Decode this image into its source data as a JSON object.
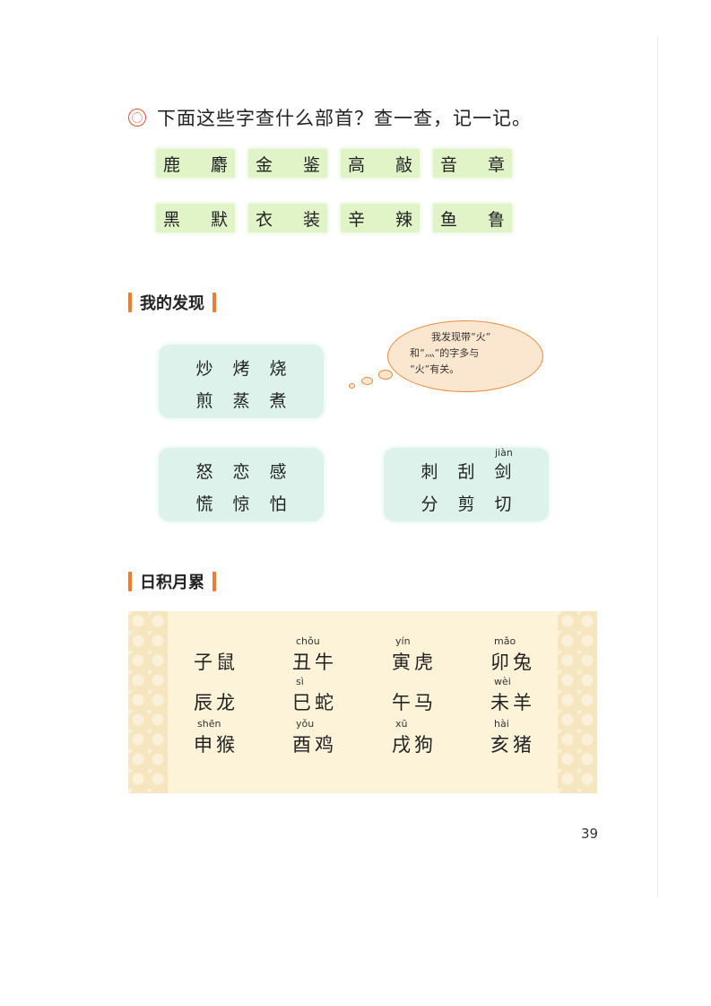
{
  "exercise": {
    "title": "下面这些字查什么部首？查一查，记一记。",
    "row1": [
      "鹿 麝",
      "金 鉴",
      "高 敲",
      "音 章"
    ],
    "row2": [
      "黑 默",
      "衣 装",
      "辛 辣",
      "鱼 鲁"
    ]
  },
  "section1": {
    "title": "我的发现",
    "box1": {
      "line1": [
        "炒",
        "烤",
        "烧"
      ],
      "line2": [
        "煎",
        "蒸",
        "煮"
      ]
    },
    "box2": {
      "line1": [
        "怒",
        "恋",
        "感"
      ],
      "line2": [
        "慌",
        "惊",
        "怕"
      ]
    },
    "box3": {
      "line1": [
        "刺",
        "刮",
        "剑"
      ],
      "line2": [
        "分",
        "剪",
        "切"
      ],
      "pinyin": "jiàn"
    },
    "bubble": {
      "line1": "我发现带“火”",
      "line2": "和“灬”的字多与",
      "line3": "“火”有关。"
    }
  },
  "section2": {
    "title": "日积月累",
    "zodiac": [
      {
        "pinyin": "",
        "text": "子鼠"
      },
      {
        "pinyin": "chǒu",
        "text": "丑牛"
      },
      {
        "pinyin": "yín",
        "text": "寅虎"
      },
      {
        "pinyin": "mǎo",
        "text": "卯兔"
      },
      {
        "pinyin": "",
        "text": "辰龙"
      },
      {
        "pinyin": "sì",
        "text": "巳蛇"
      },
      {
        "pinyin": "",
        "text": "午马"
      },
      {
        "pinyin": "wèi",
        "text": "未羊"
      },
      {
        "pinyin": "shēn",
        "text": "申猴"
      },
      {
        "pinyin": "yǒu",
        "text": "酉鸡"
      },
      {
        "pinyin": "xū",
        "text": "戌狗"
      },
      {
        "pinyin": "hài",
        "text": "亥猪"
      }
    ]
  },
  "page_number": "39",
  "colors": {
    "tile_green": "#e0f4c8",
    "box_mint": "#dcf2ea",
    "accent_orange": "#f07d2b",
    "panel_cream": "#fdf3d8"
  }
}
